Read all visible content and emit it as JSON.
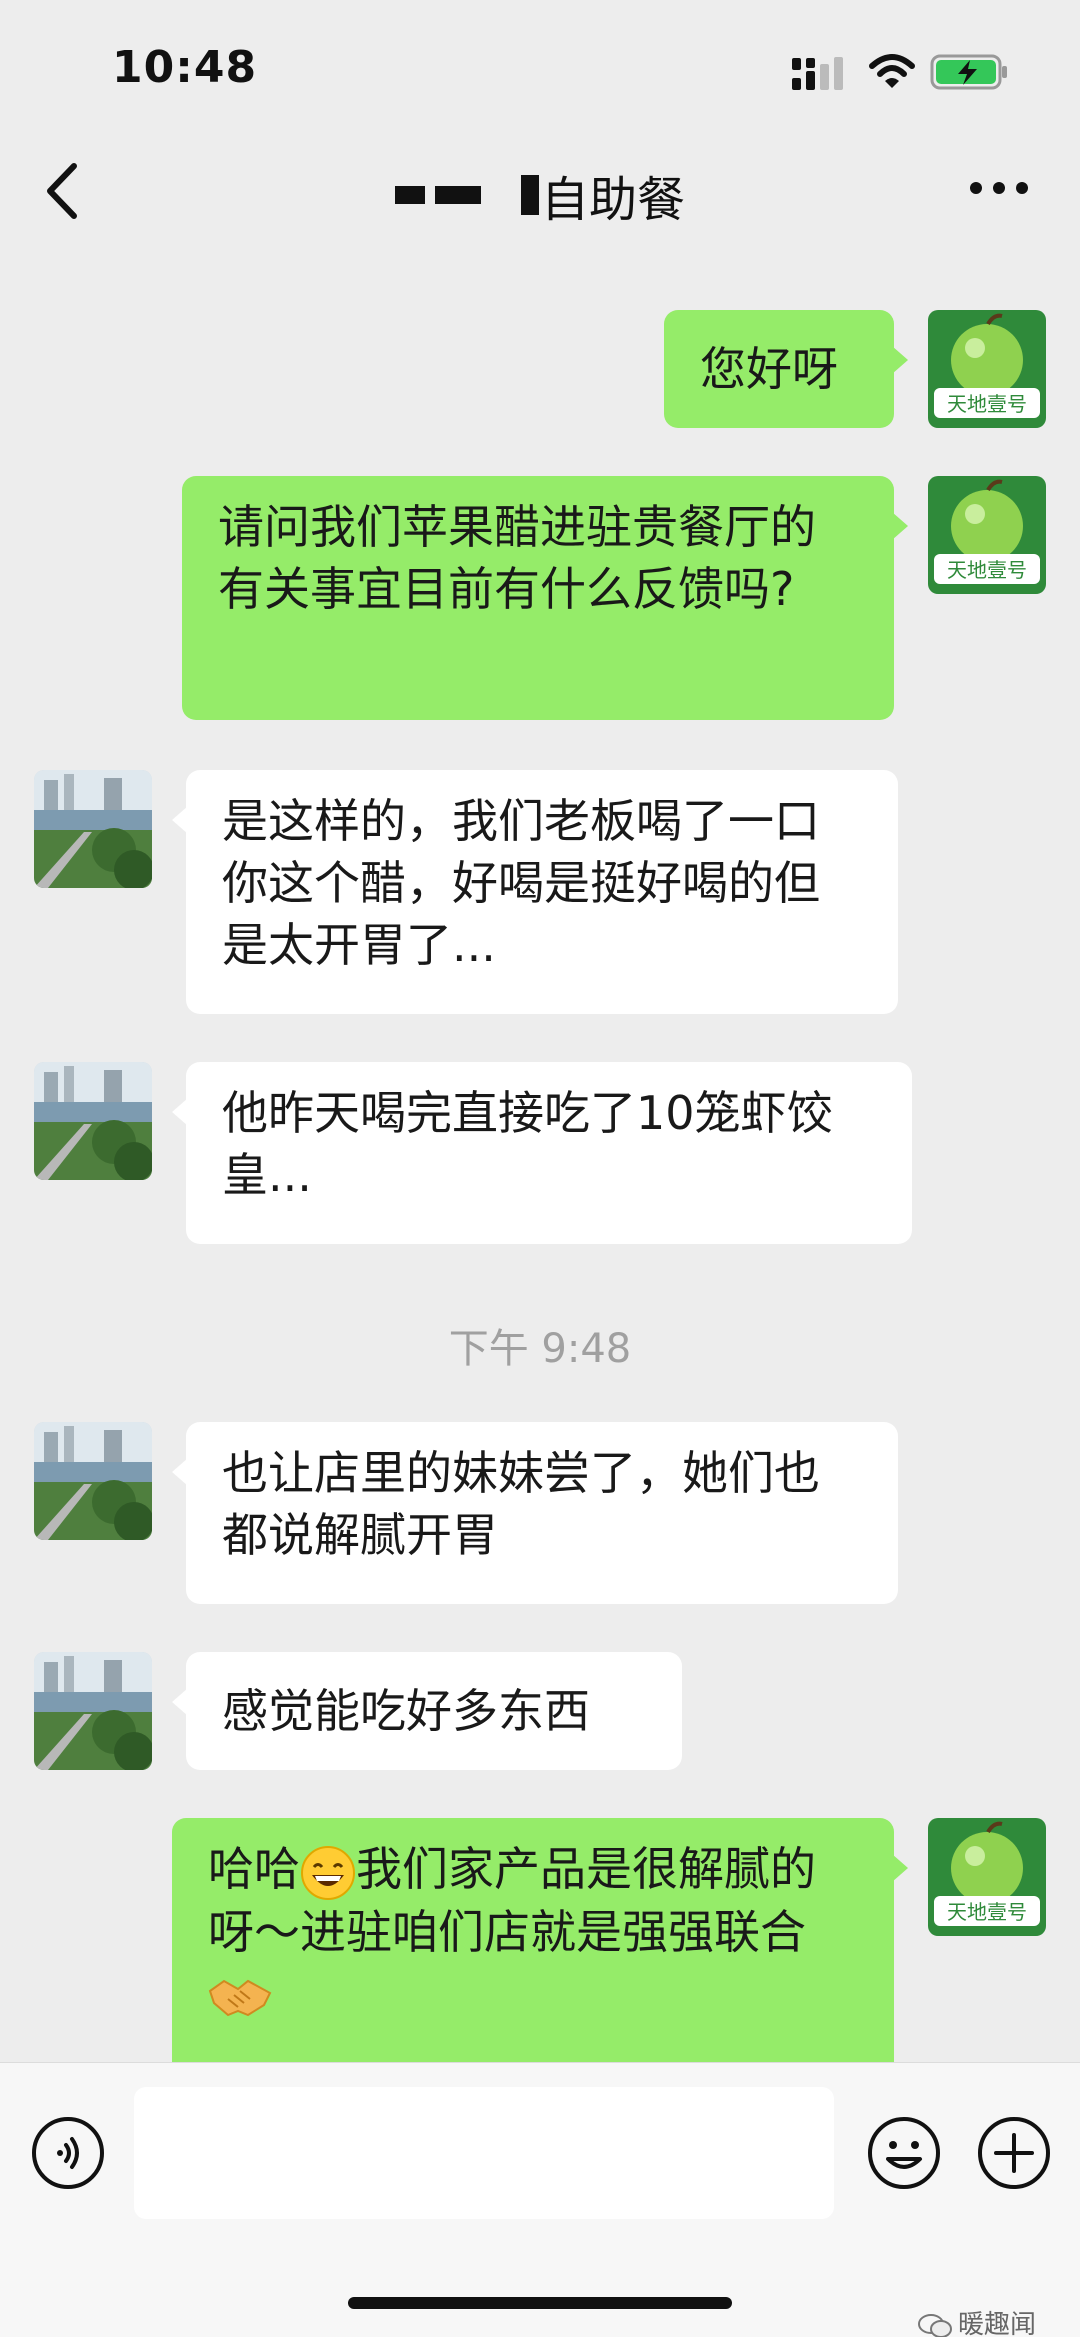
{
  "status_bar": {
    "time": "10:48"
  },
  "nav": {
    "title": "自助餐"
  },
  "me_avatar_text": "天地壹号",
  "messages": [
    {
      "from": "me",
      "text": "您好呀"
    },
    {
      "from": "me",
      "text": "请问我们苹果醋进驻贵餐厅的有关事宜目前有什么反馈吗?"
    },
    {
      "from": "them",
      "text": "是这样的，我们老板喝了一口你这个醋，好喝是挺好喝的但是太开胃了..."
    },
    {
      "from": "them",
      "text": "他昨天喝完直接吃了10笼虾饺皇..."
    },
    {
      "from": "them",
      "text": "也让店里的妹妹尝了，她们也都说解腻开胃"
    },
    {
      "from": "them",
      "text": "感觉能吃好多东西"
    },
    {
      "from": "me",
      "text_a": "哈哈",
      "text_b": "我们家产品是很解腻的呀～进驻咱们店就是强强联合"
    }
  ],
  "timestamp": "下午 9:48",
  "watermark": "暖趣闻",
  "colors": {
    "me_bubble": "#95ec69",
    "them_bubble": "#ffffff",
    "background": "#ededed"
  },
  "icons": [
    "back-icon",
    "more-icon",
    "voice-icon",
    "emoji-icon",
    "plus-icon",
    "grin-emoji",
    "handshake-emoji"
  ]
}
